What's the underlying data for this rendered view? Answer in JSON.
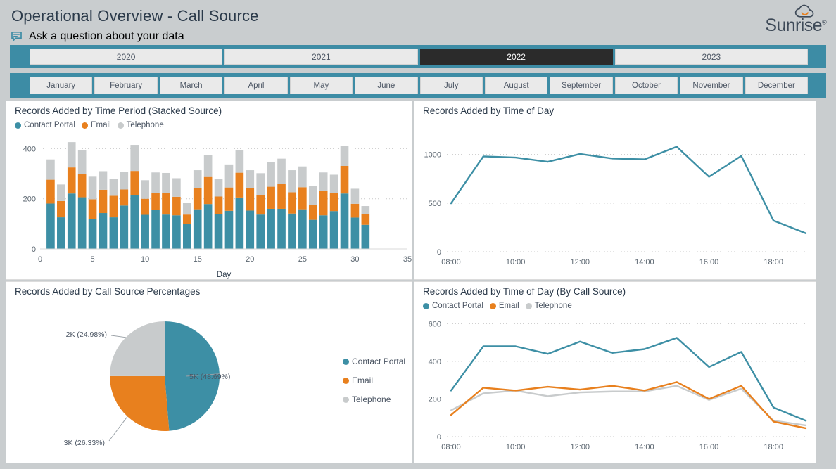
{
  "header": {
    "title": "Operational Overview - Call Source",
    "qna_label": "Ask a question about your data",
    "qna_icon": "chat-bubble-icon",
    "logo_text": "Sunrise",
    "logo_trademark": "®",
    "logo_icon": "sun-cloud-icon"
  },
  "colors": {
    "accent_teal": "#3d8ca5",
    "contact_portal": "#3d8fa5",
    "email": "#e8801e",
    "telephone": "#c8cbcc",
    "selected_bg": "#2b2b2b",
    "page_bg": "#c9cdcf",
    "title_text": "#2b3a4a"
  },
  "year_slicer": {
    "name": "year-slicer",
    "options": [
      "2020",
      "2021",
      "2022",
      "2023"
    ],
    "selected": "2022"
  },
  "month_slicer": {
    "name": "month-slicer",
    "options": [
      "January",
      "February",
      "March",
      "April",
      "May",
      "June",
      "July",
      "August",
      "September",
      "October",
      "November",
      "December"
    ],
    "selected": null
  },
  "panels": {
    "stacked_bar": {
      "title": "Records Added by Time Period (Stacked Source)"
    },
    "line_total": {
      "title": "Records Added by Time of Day"
    },
    "pie": {
      "title": "Records Added by Call Source Percentages"
    },
    "line_source": {
      "title": "Records Added by Time of Day (By Call Source)"
    }
  },
  "legend": {
    "contact_portal": "Contact Portal",
    "email": "Email",
    "telephone": "Telephone"
  },
  "chart_data": [
    {
      "id": "stacked-bar-records-by-day",
      "type": "bar",
      "stacked": true,
      "title": "Records Added by Time Period (Stacked Source)",
      "xlabel": "Day",
      "ylabel": "",
      "xlim": [
        0,
        35
      ],
      "ylim": [
        0,
        460
      ],
      "ytick_values": [
        0,
        200,
        400
      ],
      "xtick_values": [
        0,
        5,
        10,
        15,
        20,
        25,
        30,
        35
      ],
      "grid": true,
      "legend_position": "top-left",
      "categories": [
        1,
        2,
        3,
        4,
        5,
        6,
        7,
        8,
        9,
        10,
        11,
        12,
        13,
        14,
        15,
        16,
        17,
        18,
        19,
        20,
        21,
        22,
        23,
        24,
        25,
        26,
        27,
        28,
        29,
        30,
        31
      ],
      "series": [
        {
          "name": "Contact Portal",
          "color": "#3d8fa5",
          "values": [
            181,
            126,
            221,
            206,
            119,
            143,
            126,
            173,
            214,
            136,
            155,
            137,
            134,
            101,
            158,
            179,
            138,
            152,
            205,
            153,
            137,
            160,
            160,
            141,
            158,
            116,
            134,
            151,
            221,
            125,
            96
          ]
        },
        {
          "name": "Email",
          "color": "#e8801e",
          "values": [
            95,
            65,
            104,
            92,
            79,
            93,
            86,
            64,
            97,
            64,
            69,
            87,
            74,
            36,
            84,
            108,
            71,
            93,
            99,
            91,
            79,
            88,
            99,
            85,
            88,
            58,
            96,
            73,
            110,
            55,
            44
          ]
        },
        {
          "name": "Telephone",
          "color": "#c8cbcc",
          "values": [
            81,
            66,
            101,
            96,
            90,
            74,
            67,
            71,
            104,
            74,
            81,
            79,
            74,
            48,
            72,
            87,
            70,
            92,
            90,
            70,
            86,
            99,
            101,
            88,
            83,
            78,
            75,
            72,
            79,
            60,
            31
          ]
        }
      ]
    },
    {
      "id": "line-records-by-time-of-day",
      "type": "line",
      "title": "Records Added by Time of Day",
      "xlabel": "",
      "ylabel": "",
      "ylim": [
        0,
        1200
      ],
      "ytick_values": [
        0,
        500,
        1000
      ],
      "xtick_labels": [
        "08:00",
        "10:00",
        "12:00",
        "14:00",
        "16:00",
        "18:00"
      ],
      "grid": true,
      "x": [
        "08:00",
        "09:00",
        "10:00",
        "11:00",
        "12:00",
        "13:00",
        "14:00",
        "15:00",
        "16:00",
        "17:00",
        "18:00",
        "19:00"
      ],
      "series": [
        {
          "name": "Total",
          "color": "#3d8fa5",
          "values": [
            498,
            980,
            968,
            925,
            1005,
            958,
            950,
            1080,
            770,
            985,
            320,
            190
          ]
        }
      ]
    },
    {
      "id": "pie-call-source-percentages",
      "type": "pie",
      "title": "Records Added by Call Source Percentages",
      "legend_position": "right",
      "slices": [
        {
          "name": "Contact Portal",
          "label": "5K (48.69%)",
          "percent": 48.69,
          "value_label": "5K",
          "color": "#3d8fa5"
        },
        {
          "name": "Email",
          "label": "3K (26.33%)",
          "percent": 26.33,
          "value_label": "3K",
          "color": "#e8801e"
        },
        {
          "name": "Telephone",
          "label": "2K (24.98%)",
          "percent": 24.98,
          "value_label": "2K",
          "color": "#c8cbcc"
        }
      ]
    },
    {
      "id": "line-records-by-time-of-day-by-source",
      "type": "line",
      "title": "Records Added by Time of Day (By Call Source)",
      "xlabel": "",
      "ylabel": "",
      "ylim": [
        0,
        620
      ],
      "ytick_values": [
        0,
        200,
        400,
        600
      ],
      "xtick_labels": [
        "08:00",
        "10:00",
        "12:00",
        "14:00",
        "16:00",
        "18:00"
      ],
      "grid": true,
      "legend_position": "top-left",
      "x": [
        "08:00",
        "09:00",
        "10:00",
        "11:00",
        "12:00",
        "13:00",
        "14:00",
        "15:00",
        "16:00",
        "17:00",
        "18:00",
        "19:00"
      ],
      "series": [
        {
          "name": "Contact Portal",
          "color": "#3d8fa5",
          "values": [
            245,
            480,
            480,
            440,
            505,
            445,
            465,
            525,
            370,
            450,
            155,
            85
          ]
        },
        {
          "name": "Email",
          "color": "#e8801e",
          "values": [
            115,
            260,
            245,
            265,
            250,
            270,
            245,
            290,
            200,
            270,
            80,
            45
          ]
        },
        {
          "name": "Telephone",
          "color": "#c8cbcc",
          "values": [
            140,
            230,
            245,
            215,
            235,
            240,
            240,
            270,
            195,
            255,
            85,
            60
          ]
        }
      ]
    }
  ]
}
